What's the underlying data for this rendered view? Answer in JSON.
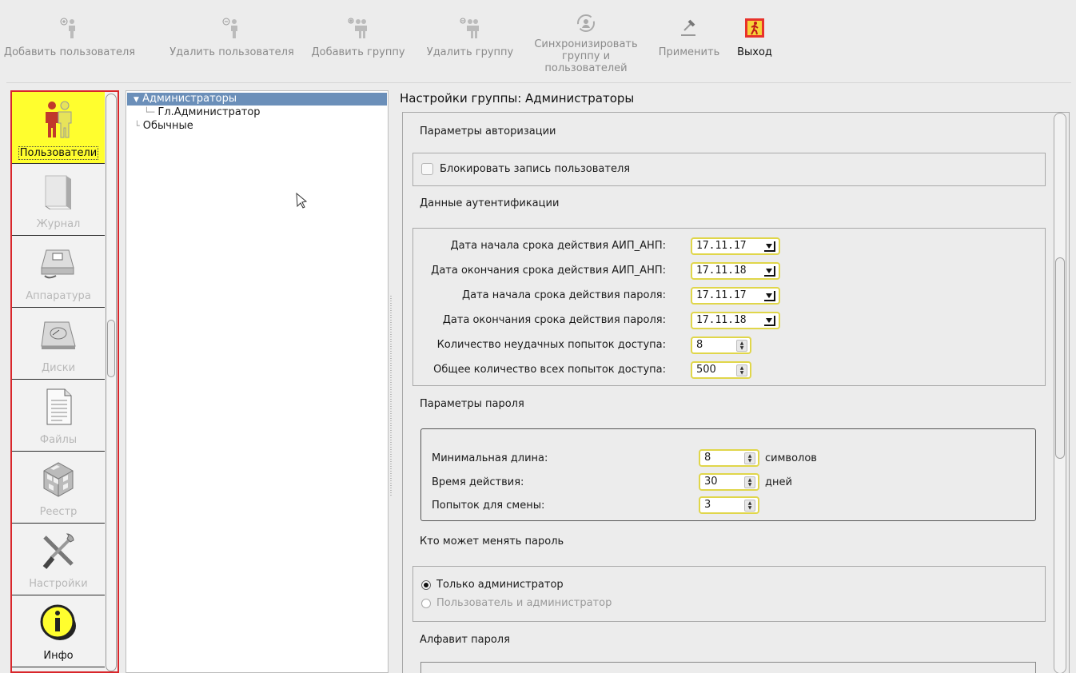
{
  "toolbar": {
    "add_user": "Добавить пользователя",
    "delete_user": "Удалить пользователя",
    "add_group": "Добавить группу",
    "delete_group": "Удалить группу",
    "sync_line1": "Синхронизировать",
    "sync_line2": "группу и",
    "sync_line3": "пользователей",
    "apply": "Применить",
    "exit": "Выход"
  },
  "nav": {
    "items": [
      {
        "label": "Пользователи",
        "icon": "users-icon",
        "active": true
      },
      {
        "label": "Журнал",
        "icon": "journal-icon"
      },
      {
        "label": "Аппаратура",
        "icon": "hardware-icon"
      },
      {
        "label": "Диски",
        "icon": "disk-icon"
      },
      {
        "label": "Файлы",
        "icon": "file-icon"
      },
      {
        "label": "Реестр",
        "icon": "registry-icon"
      },
      {
        "label": "Настройки",
        "icon": "settings-icon"
      },
      {
        "label": "Инфо",
        "icon": "info-icon"
      }
    ]
  },
  "tree": {
    "group_admins": "Администраторы",
    "chief_admin": "Гл.Администратор",
    "group_regular": "Обычные"
  },
  "content": {
    "title": "Настройки группы: Администраторы",
    "auth_params": "Параметры авторизации",
    "block_user": "Блокировать запись пользователя",
    "auth_data": "Данные аутентификации",
    "fields": [
      {
        "label": "Дата начала срока действия АИП_АНП:",
        "value": "17.11.17"
      },
      {
        "label": "Дата окончания срока действия АИП_АНП:",
        "value": "17.11.18"
      },
      {
        "label": "Дата начала срока действия пароля:",
        "value": "17.11.17"
      },
      {
        "label": "Дата окончания срока действия пароля:",
        "value": "17.11.18"
      },
      {
        "label": "Количество неудачных попыток доступа:",
        "value": "8"
      },
      {
        "label": "Общее количество всех попыток доступа:",
        "value": "500"
      }
    ],
    "password_params": "Параметры пароля",
    "pw_fields": [
      {
        "label": "Минимальная длина:",
        "value": "8",
        "suffix": "символов"
      },
      {
        "label": "Время действия:",
        "value": "30",
        "suffix": "дней"
      },
      {
        "label": "Попыток для смены:",
        "value": "3",
        "suffix": ""
      }
    ],
    "who_can_change": "Кто может менять пароль",
    "radio_admin_only": "Только администратор",
    "radio_user_admin": "Пользователь и администратор",
    "alphabet": "Алфавит пароля"
  }
}
